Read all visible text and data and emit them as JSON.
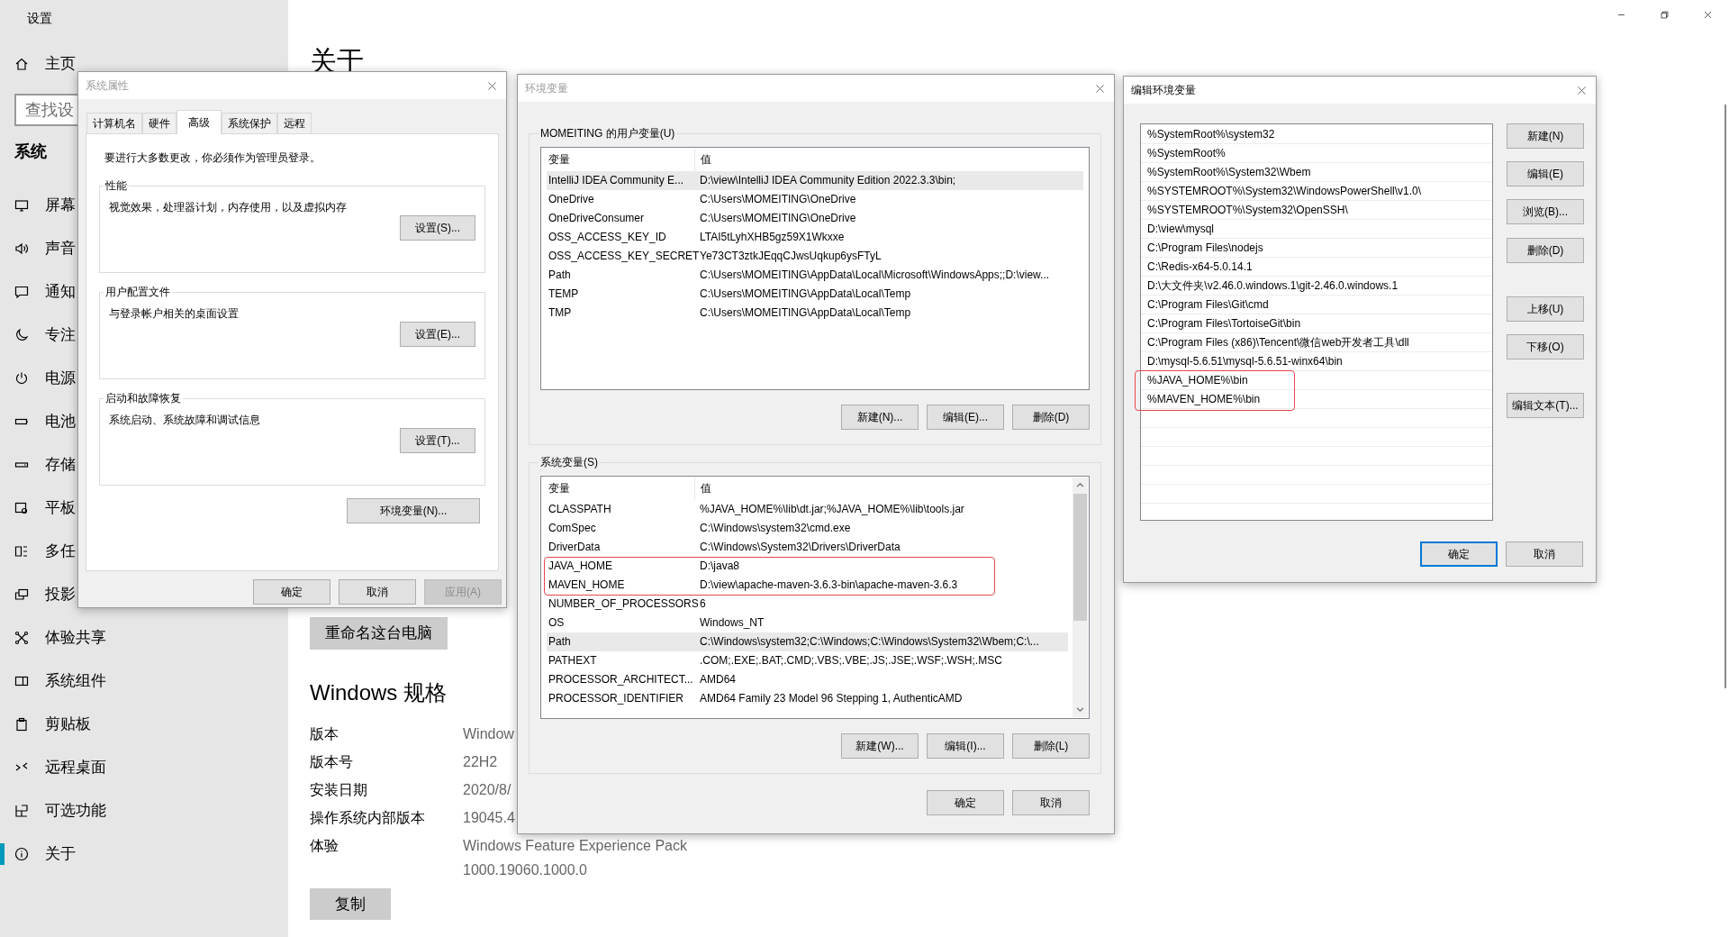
{
  "settings_window": {
    "title": "设置",
    "home": {
      "label": "主页"
    },
    "search": {
      "placeholder": "查找设"
    },
    "section": "系统",
    "nav": [
      {
        "label": "屏幕",
        "kind": "monitor",
        "selected": false
      },
      {
        "label": "声音",
        "kind": "speaker",
        "selected": false
      },
      {
        "label": "通知",
        "kind": "message",
        "selected": false
      },
      {
        "label": "专注",
        "kind": "moon",
        "selected": false
      },
      {
        "label": "电源",
        "kind": "power",
        "selected": false
      },
      {
        "label": "电池",
        "kind": "battery",
        "selected": false
      },
      {
        "label": "存储",
        "kind": "storage",
        "selected": false
      },
      {
        "label": "平板",
        "kind": "tablet",
        "selected": false
      },
      {
        "label": "多任",
        "kind": "multitask",
        "selected": false
      },
      {
        "label": "投影",
        "kind": "project",
        "selected": false
      },
      {
        "label": "体验共享",
        "kind": "share",
        "selected": false
      },
      {
        "label": "系统组件",
        "kind": "components",
        "selected": false
      },
      {
        "label": "剪贴板",
        "kind": "clipboard",
        "selected": false
      },
      {
        "label": "远程桌面",
        "kind": "remote",
        "selected": false
      },
      {
        "label": "可选功能",
        "kind": "features",
        "selected": false
      },
      {
        "label": "关于",
        "kind": "info",
        "selected": true
      }
    ],
    "page": {
      "title": "关于",
      "rename_button": "重命名这台电脑",
      "spec_title": "Windows 规格",
      "specs": [
        {
          "label": "版本",
          "value": "Window"
        },
        {
          "label": "版本号",
          "value": "22H2"
        },
        {
          "label": "安装日期",
          "value": "2020/8/"
        },
        {
          "label": "操作系统内部版本",
          "value": "19045.4"
        },
        {
          "label": "体验",
          "value": "Windows Feature Experience Pack",
          "value_2": "1000.19060.1000.0"
        }
      ],
      "copy_button": "复制"
    }
  },
  "system_properties": {
    "title": "系统属性",
    "active": false,
    "tabs": [
      {
        "label": "计算机名",
        "selected": false
      },
      {
        "label": "硬件",
        "selected": false
      },
      {
        "label": "高级",
        "selected": true
      },
      {
        "label": "系统保护",
        "selected": false
      },
      {
        "label": "远程",
        "selected": false
      }
    ],
    "notice": "要进行大多数更改，你必须作为管理员登录。",
    "groups": [
      {
        "title": "性能",
        "description": "视觉效果，处理器计划，内存使用，以及虚拟内存",
        "button": "设置(S)..."
      },
      {
        "title": "用户配置文件",
        "description": "与登录帐户相关的桌面设置",
        "button": "设置(E)..."
      },
      {
        "title": "启动和故障恢复",
        "description": "系统启动、系统故障和调试信息",
        "button": "设置(T)..."
      }
    ],
    "env_button": "环境变量(N)...",
    "buttons": [
      {
        "label": "确定",
        "disabled": false
      },
      {
        "label": "取消",
        "disabled": false
      },
      {
        "label": "应用(A)",
        "disabled": true
      }
    ]
  },
  "environment_variables": {
    "title": "环境变量",
    "active": false,
    "user_group": {
      "title": "MOMEITING 的用户变量(U)",
      "columns": [
        "变量",
        "值"
      ],
      "rows": [
        {
          "name": "IntelliJ IDEA Community E...",
          "value": "D:\\view\\IntelliJ IDEA Community Edition 2022.3.3\\bin;",
          "selected": true,
          "marked": false
        },
        {
          "name": "OneDrive",
          "value": "C:\\Users\\MOMEITING\\OneDrive",
          "selected": false,
          "marked": false
        },
        {
          "name": "OneDriveConsumer",
          "value": "C:\\Users\\MOMEITING\\OneDrive",
          "selected": false,
          "marked": false
        },
        {
          "name": "OSS_ACCESS_KEY_ID",
          "value": "LTAI5tLyhXHB5gz59X1Wkxxe",
          "selected": false,
          "marked": false
        },
        {
          "name": "OSS_ACCESS_KEY_SECRET",
          "value": "Ye73CT3ztkJEqqCJwsUqkup6ysFTyL",
          "selected": false,
          "marked": false
        },
        {
          "name": "Path",
          "value": "C:\\Users\\MOMEITING\\AppData\\Local\\Microsoft\\WindowsApps;;D:\\view...",
          "selected": false,
          "marked": false
        },
        {
          "name": "TEMP",
          "value": "C:\\Users\\MOMEITING\\AppData\\Local\\Temp",
          "selected": false,
          "marked": false
        },
        {
          "name": "TMP",
          "value": "C:\\Users\\MOMEITING\\AppData\\Local\\Temp",
          "selected": false,
          "marked": false
        }
      ],
      "buttons": [
        "新建(N)...",
        "编辑(E)...",
        "删除(D)"
      ]
    },
    "system_group": {
      "title": "系统变量(S)",
      "columns": [
        "变量",
        "值"
      ],
      "rows": [
        {
          "name": "CLASSPATH",
          "value": "%JAVA_HOME%\\lib\\dt.jar;%JAVA_HOME%\\lib\\tools.jar",
          "selected": false,
          "marked": false
        },
        {
          "name": "ComSpec",
          "value": "C:\\Windows\\system32\\cmd.exe",
          "selected": false,
          "marked": false
        },
        {
          "name": "DriverData",
          "value": "C:\\Windows\\System32\\Drivers\\DriverData",
          "selected": false,
          "marked": false
        },
        {
          "name": "JAVA_HOME",
          "value": "D:\\java8",
          "selected": false,
          "marked": true
        },
        {
          "name": "MAVEN_HOME",
          "value": "D:\\view\\apache-maven-3.6.3-bin\\apache-maven-3.6.3",
          "selected": false,
          "marked": true
        },
        {
          "name": "NUMBER_OF_PROCESSORS",
          "value": "6",
          "selected": false,
          "marked": false
        },
        {
          "name": "OS",
          "value": "Windows_NT",
          "selected": false,
          "marked": false
        },
        {
          "name": "Path",
          "value": "C:\\Windows\\system32;C:\\Windows;C:\\Windows\\System32\\Wbem;C:\\...",
          "selected": true,
          "marked": false
        },
        {
          "name": "PATHEXT",
          "value": ".COM;.EXE;.BAT;.CMD;.VBS;.VBE;.JS;.JSE;.WSF;.WSH;.MSC",
          "selected": false,
          "marked": false
        },
        {
          "name": "PROCESSOR_ARCHITECT...",
          "value": "AMD64",
          "selected": false,
          "marked": false
        },
        {
          "name": "PROCESSOR_IDENTIFIER",
          "value": "AMD64 Family 23 Model 96 Stepping 1, AuthenticAMD",
          "selected": false,
          "marked": false
        }
      ],
      "buttons": [
        "新建(W)...",
        "编辑(I)...",
        "删除(L)"
      ]
    },
    "buttons": [
      "确定",
      "取消"
    ]
  },
  "edit_environment_variable": {
    "title": "编辑环境变量",
    "active": true,
    "entries": [
      {
        "text": "%SystemRoot%\\system32",
        "marked": false
      },
      {
        "text": "%SystemRoot%",
        "marked": false
      },
      {
        "text": "%SystemRoot%\\System32\\Wbem",
        "marked": false
      },
      {
        "text": "%SYSTEMROOT%\\System32\\WindowsPowerShell\\v1.0\\",
        "marked": false
      },
      {
        "text": "%SYSTEMROOT%\\System32\\OpenSSH\\",
        "marked": false
      },
      {
        "text": "D:\\view\\mysql",
        "marked": false
      },
      {
        "text": "C:\\Program Files\\nodejs",
        "marked": false
      },
      {
        "text": "C:\\Redis-x64-5.0.14.1",
        "marked": false
      },
      {
        "text": "D:\\大文件夹\\v2.46.0.windows.1\\git-2.46.0.windows.1",
        "marked": false
      },
      {
        "text": "C:\\Program Files\\Git\\cmd",
        "marked": false
      },
      {
        "text": "C:\\Program Files\\TortoiseGit\\bin",
        "marked": false
      },
      {
        "text": "C:\\Program Files (x86)\\Tencent\\微信web开发者工具\\dll",
        "marked": false
      },
      {
        "text": "D:\\mysql-5.6.51\\mysql-5.6.51-winx64\\bin",
        "marked": false
      },
      {
        "text": "%JAVA_HOME%\\bin",
        "marked": true
      },
      {
        "text": "%MAVEN_HOME%\\bin",
        "marked": true
      }
    ],
    "side_buttons": [
      "新建(N)",
      "编辑(E)",
      "浏览(B)...",
      "删除(D)",
      "上移(U)",
      "下移(O)",
      "编辑文本(T)..."
    ],
    "buttons": [
      {
        "label": "确定",
        "default": true
      },
      {
        "label": "取消",
        "default": false
      }
    ]
  }
}
